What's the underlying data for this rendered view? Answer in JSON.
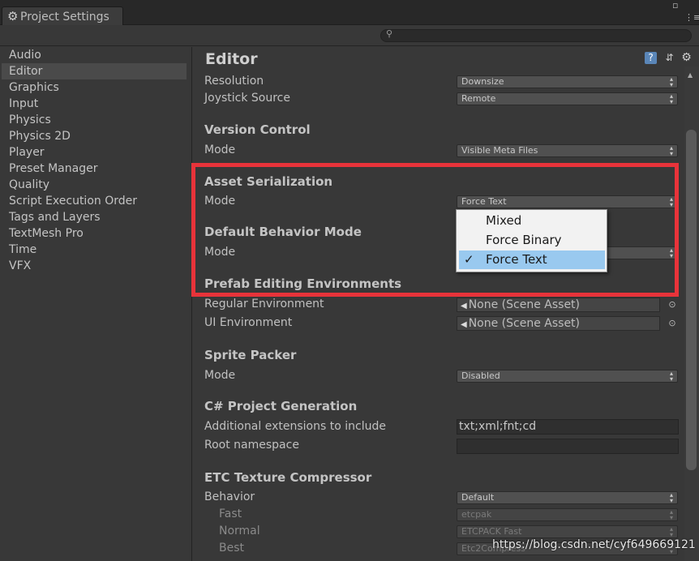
{
  "window": {
    "tab_title": "Project Settings",
    "search_placeholder": ""
  },
  "sidebar": {
    "items": [
      {
        "label": "Audio"
      },
      {
        "label": "Editor",
        "selected": true
      },
      {
        "label": "Graphics"
      },
      {
        "label": "Input"
      },
      {
        "label": "Physics"
      },
      {
        "label": "Physics 2D"
      },
      {
        "label": "Player"
      },
      {
        "label": "Preset Manager"
      },
      {
        "label": "Quality"
      },
      {
        "label": "Script Execution Order"
      },
      {
        "label": "Tags and Layers"
      },
      {
        "label": "TextMesh Pro"
      },
      {
        "label": "Time"
      },
      {
        "label": "VFX"
      }
    ]
  },
  "header": {
    "title": "Editor",
    "icons": [
      "help-icon",
      "preset-icon",
      "settings-gear-icon"
    ]
  },
  "rows": {
    "resolution": {
      "label": "Resolution",
      "value": "Downsize"
    },
    "joystick": {
      "label": "Joystick Source",
      "value": "Remote"
    },
    "version_control": {
      "title": "Version Control",
      "mode_label": "Mode",
      "mode_value": "Visible Meta Files"
    },
    "asset_serialization": {
      "title": "Asset Serialization",
      "mode_label": "Mode",
      "mode_value": "Force Text"
    },
    "default_behavior": {
      "title": "Default Behavior Mode",
      "mode_label": "Mode",
      "mode_value": ""
    },
    "prefab_env": {
      "title": "Prefab Editing Environments",
      "regular_label": "Regular Environment",
      "regular_value": "None (Scene Asset)",
      "ui_label": "UI Environment",
      "ui_value": "None (Scene Asset)"
    },
    "sprite_packer": {
      "title": "Sprite Packer",
      "mode_label": "Mode",
      "mode_value": "Disabled"
    },
    "csharp": {
      "title": "C# Project Generation",
      "ext_label": "Additional extensions to include",
      "ext_value": "txt;xml;fnt;cd",
      "ns_label": "Root namespace",
      "ns_value": ""
    },
    "etc": {
      "title": "ETC Texture Compressor",
      "behavior_label": "Behavior",
      "behavior_value": "Default",
      "fast_label": "Fast",
      "fast_value": "etcpak",
      "normal_label": "Normal",
      "normal_value": "ETCPACK Fast",
      "best_label": "Best",
      "best_value": "Etc2Compress"
    }
  },
  "popup": {
    "options": [
      {
        "label": "Mixed",
        "checked": false
      },
      {
        "label": "Force Binary",
        "checked": false
      },
      {
        "label": "Force Text",
        "checked": true
      }
    ],
    "check_glyph": "✓"
  },
  "watermark": "https://blog.csdn.net/cyf649669121",
  "colors": {
    "highlight_border": "#e8333a",
    "popup_selected": "#99c9ef"
  }
}
